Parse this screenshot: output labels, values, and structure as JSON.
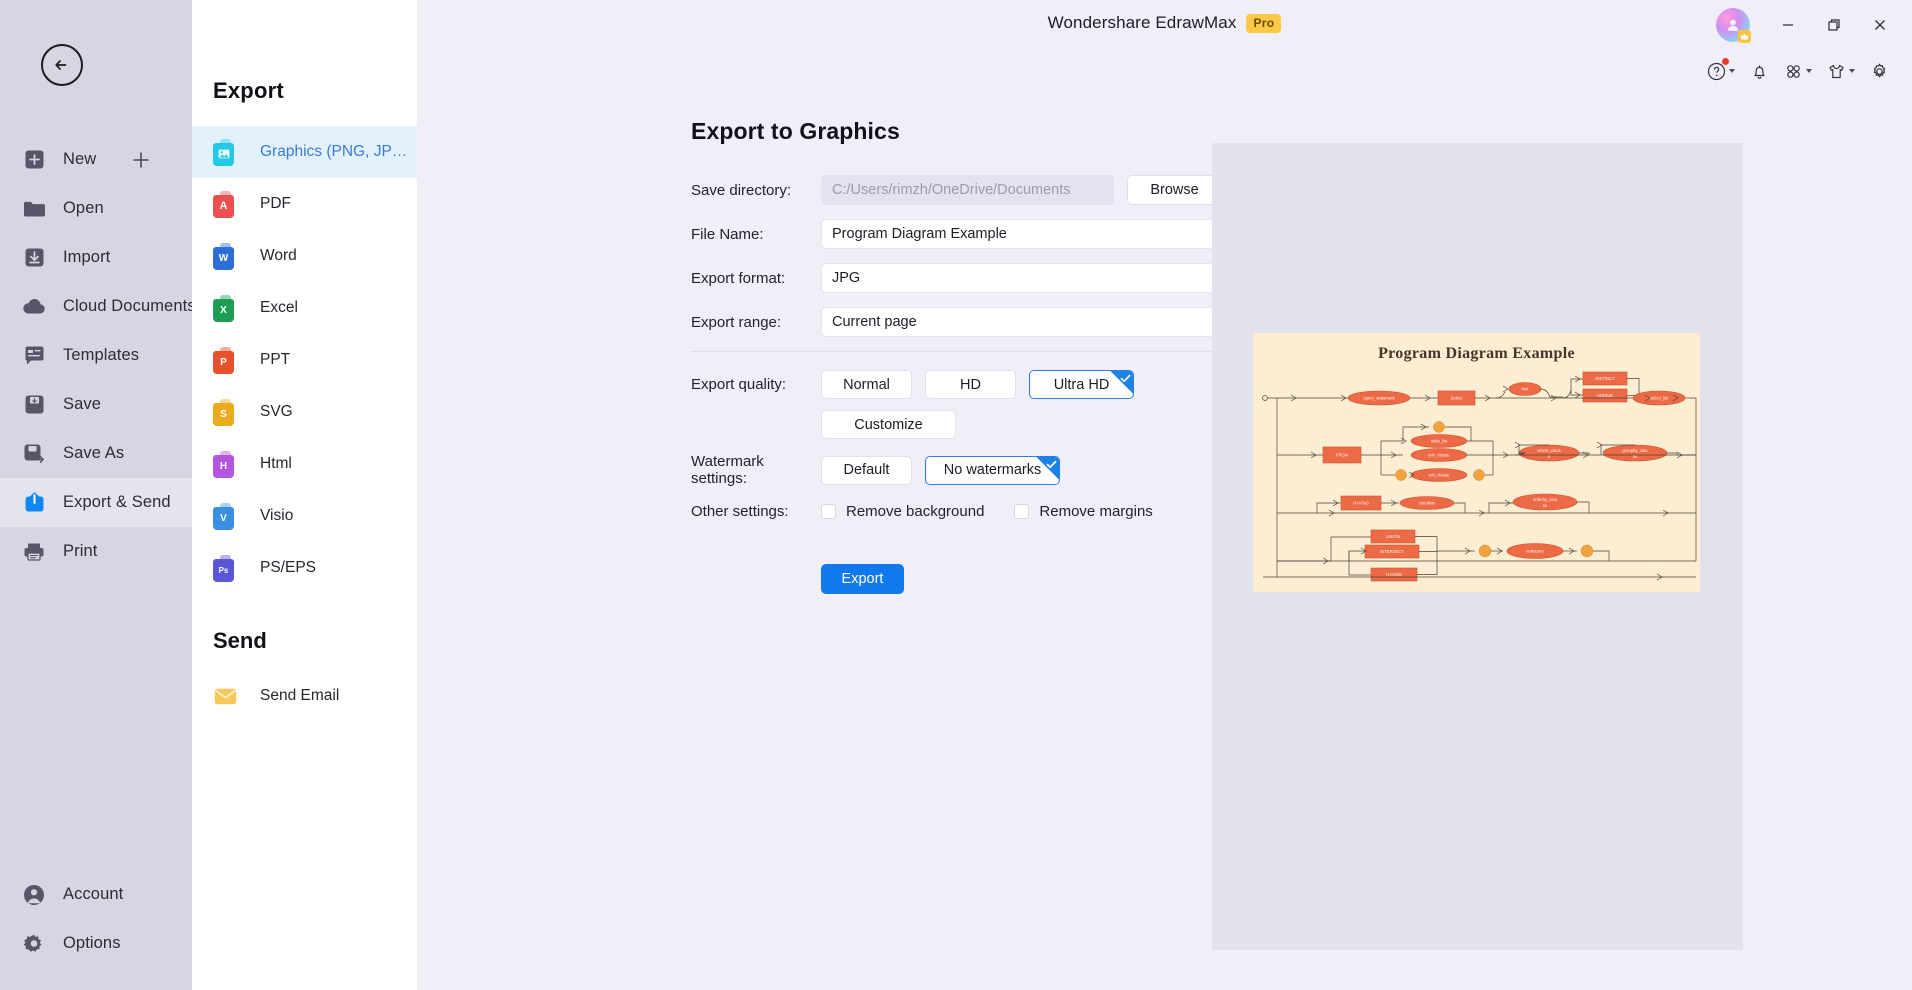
{
  "titlebar": {
    "app_title": "Wondershare EdrawMax",
    "pro_badge": "Pro",
    "minimize": "minimize-icon",
    "restore": "restore-icon",
    "close": "close-icon"
  },
  "iconbar": [
    {
      "name": "help-icon",
      "label": ""
    },
    {
      "name": "notification-bell-icon",
      "label": ""
    },
    {
      "name": "apps-grid-icon",
      "label": ""
    },
    {
      "name": "theme-shirt-icon",
      "label": ""
    },
    {
      "name": "settings-gear-icon",
      "label": ""
    }
  ],
  "leftnav": {
    "back_label": "back-arrow",
    "items": [
      {
        "label": "New",
        "icon": "plus-square-icon",
        "active": false
      },
      {
        "label": "Open",
        "icon": "folder-icon",
        "active": false
      },
      {
        "label": "Import",
        "icon": "import-icon",
        "active": false
      },
      {
        "label": "Cloud Documents",
        "icon": "cloud-icon",
        "active": false
      },
      {
        "label": "Templates",
        "icon": "templates-icon",
        "active": false
      },
      {
        "label": "Save",
        "icon": "save-icon",
        "active": false
      },
      {
        "label": "Save As",
        "icon": "save-as-icon",
        "active": false
      },
      {
        "label": "Export & Send",
        "icon": "export-send-icon",
        "active": true
      },
      {
        "label": "Print",
        "icon": "printer-icon",
        "active": false
      }
    ],
    "bottom_items": [
      {
        "label": "Account",
        "icon": "account-icon"
      },
      {
        "label": "Options",
        "icon": "options-gear-icon"
      }
    ]
  },
  "typecol": {
    "export_heading": "Export",
    "items": [
      {
        "label": "Graphics (PNG, JPG et...",
        "glyph": "",
        "color": "#25c9e8",
        "tab": "#6fe0f2",
        "active": true
      },
      {
        "label": "PDF",
        "glyph": "",
        "color": "#ec4f4f",
        "tab": "#f79494",
        "active": false
      },
      {
        "label": "Word",
        "glyph": "W",
        "color": "#2b6fd6",
        "tab": "#7aa8ea",
        "active": false
      },
      {
        "label": "Excel",
        "glyph": "X",
        "color": "#1e9e55",
        "tab": "#6cc896",
        "active": false
      },
      {
        "label": "PPT",
        "glyph": "P",
        "color": "#e8502b",
        "tab": "#f59277",
        "active": false
      },
      {
        "label": "SVG",
        "glyph": "S",
        "color": "#eaab1e",
        "tab": "#f3cd78",
        "active": false
      },
      {
        "label": "Html",
        "glyph": "H",
        "color": "#b556e0",
        "tab": "#d297ef",
        "active": false
      },
      {
        "label": "Visio",
        "glyph": "V",
        "color": "#3b8fe0",
        "tab": "#8cc0ef",
        "active": false
      },
      {
        "label": "PS/EPS",
        "glyph": "Ps",
        "color": "#5a56d6",
        "tab": "#9a97e8",
        "active": false
      }
    ],
    "send_heading": "Send",
    "send_items": [
      {
        "label": "Send Email",
        "icon": "envelope-icon"
      }
    ]
  },
  "form": {
    "page_title": "Export to Graphics",
    "save_directory_label": "Save directory:",
    "save_directory_value": "C:/Users/rimzh/OneDrive/Documents",
    "browse_label": "Browse",
    "file_name_label": "File Name:",
    "file_name_value": "Program Diagram Example",
    "export_format_label": "Export format:",
    "export_format_value": "JPG",
    "export_range_label": "Export range:",
    "export_range_value": "Current page",
    "export_quality_label": "Export quality:",
    "quality_options": [
      {
        "label": "Normal",
        "selected": false
      },
      {
        "label": "HD",
        "selected": false
      },
      {
        "label": "Ultra HD",
        "selected": true
      }
    ],
    "customize_label": "Customize",
    "watermark_label": "Watermark settings:",
    "watermark_options": [
      {
        "label": "Default",
        "selected": false
      },
      {
        "label": "No watermarks",
        "selected": true
      }
    ],
    "other_settings_label": "Other settings:",
    "checkboxes": [
      {
        "label": "Remove background",
        "checked": false
      },
      {
        "label": "Remove margins",
        "checked": false
      }
    ],
    "export_button_label": "Export",
    "accent_color": "#1279ec"
  },
  "preview": {
    "diagram_title": "Program Diagram Example",
    "nodes": [
      "query_statement",
      "Select",
      "hint",
      "DISTINCT",
      "UNIQUE",
      "select_list",
      "FROM",
      "table_list",
      "join_clause",
      "win_clause",
      "where_clause",
      "groupby_clause",
      "HAVING",
      "condition",
      "orderby_clause",
      "UNION",
      "INTERSECT",
      "HAVING",
      "subquery"
    ]
  }
}
